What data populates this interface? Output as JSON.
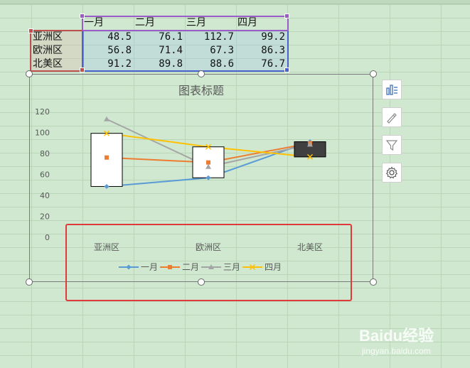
{
  "sheet": {
    "column_headers": [
      "一月",
      "二月",
      "三月",
      "四月"
    ],
    "rows": [
      {
        "region": "亚洲区",
        "values": [
          "48.5",
          "76.1",
          "112.7",
          "99.2"
        ]
      },
      {
        "region": "欧洲区",
        "values": [
          "56.8",
          "71.4",
          "67.3",
          "86.3"
        ]
      },
      {
        "region": "北美区",
        "values": [
          "91.2",
          "89.8",
          "88.6",
          "76.7"
        ]
      }
    ]
  },
  "chart_data": {
    "type": "line",
    "title": "图表标题",
    "categories": [
      "亚洲区",
      "欧洲区",
      "北美区"
    ],
    "series": [
      {
        "name": "一月",
        "values": [
          48.5,
          56.8,
          91.2
        ],
        "color": "#5b9bd5"
      },
      {
        "name": "二月",
        "values": [
          76.1,
          71.4,
          89.8
        ],
        "color": "#ed7d31"
      },
      {
        "name": "三月",
        "values": [
          112.7,
          67.3,
          88.6
        ],
        "color": "#a5a5a5"
      },
      {
        "name": "四月",
        "values": [
          99.2,
          86.3,
          76.7
        ],
        "color": "#ffc000"
      }
    ],
    "y_ticks": [
      "0",
      "20",
      "40",
      "60",
      "80",
      "100",
      "120"
    ],
    "ylim": [
      0,
      120
    ],
    "up_down_bars": true,
    "legend_position": "bottom",
    "grid": false
  },
  "chart_tools": {
    "icons": [
      "chart-elements-icon",
      "chart-style-icon",
      "chart-filter-icon",
      "chart-settings-icon"
    ]
  },
  "watermark": {
    "brand": "Baidu经验",
    "url": "jingyan.baidu.com"
  }
}
